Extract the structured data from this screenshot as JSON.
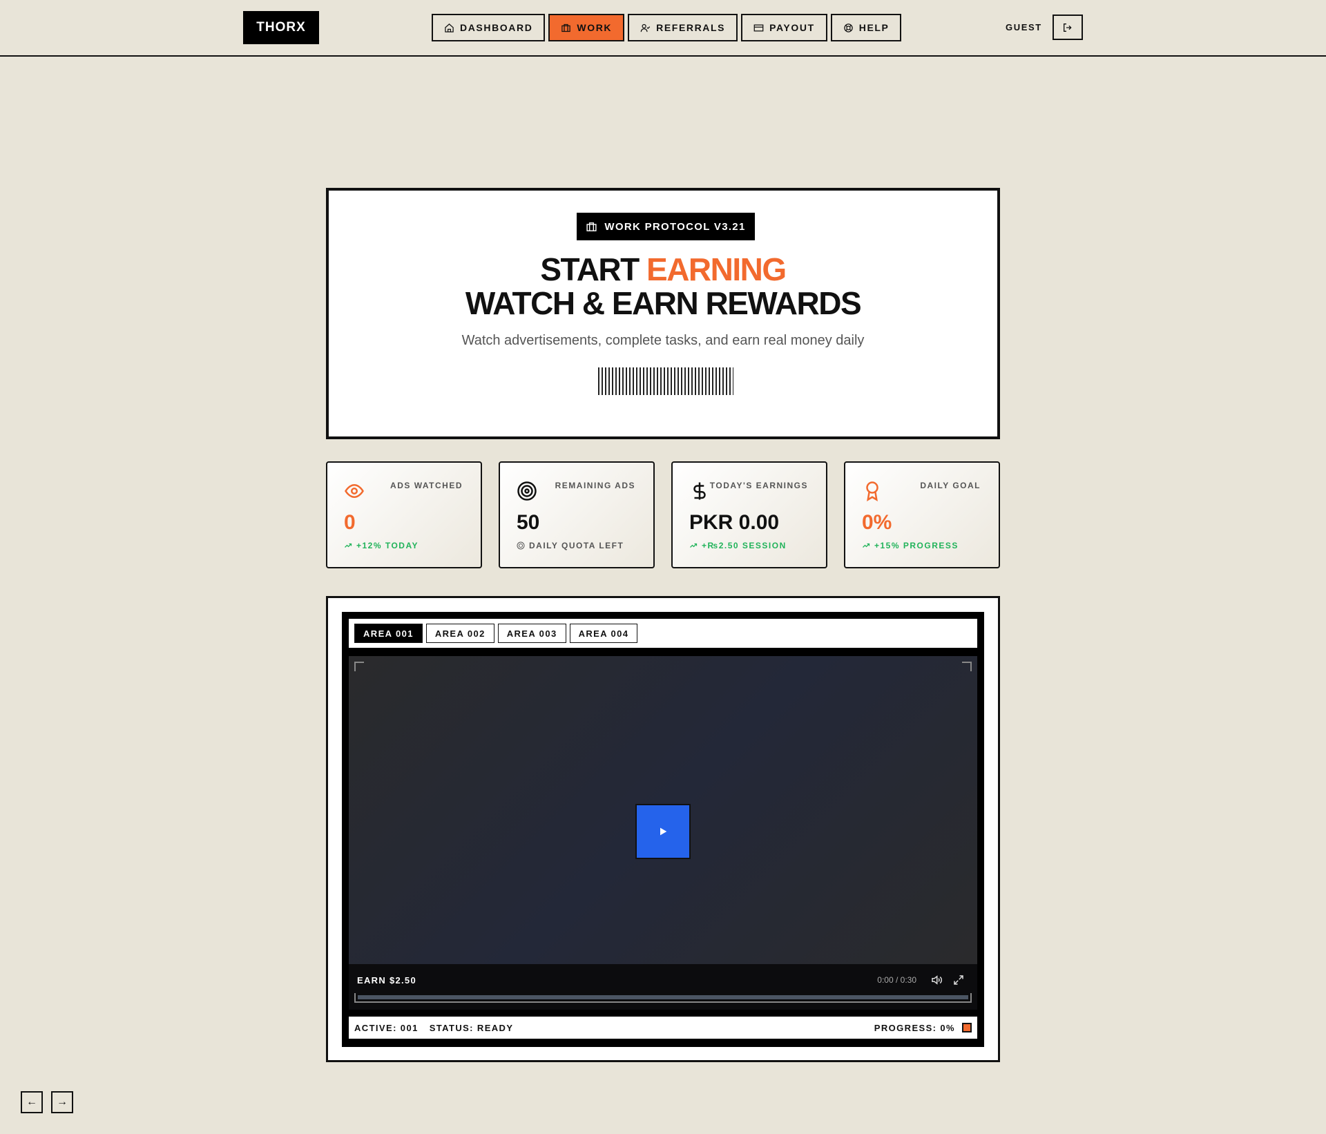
{
  "header": {
    "logo": "THORX",
    "nav": [
      {
        "label": "DASHBOARD",
        "icon": "home-icon",
        "active": false
      },
      {
        "label": "WORK",
        "icon": "briefcase-icon",
        "active": true
      },
      {
        "label": "REFERRALS",
        "icon": "user-check-icon",
        "active": false
      },
      {
        "label": "PAYOUT",
        "icon": "credit-card-icon",
        "active": false
      },
      {
        "label": "HELP",
        "icon": "lifebuoy-icon",
        "active": false
      }
    ],
    "user": "GUEST",
    "logout_icon": "logout-icon"
  },
  "hero": {
    "badge": "WORK PROTOCOL V3.21",
    "title_part1": "START ",
    "title_highlight": "EARNING",
    "title_line2": "WATCH & EARN REWARDS",
    "subtitle": "Watch advertisements, complete tasks, and earn real money daily"
  },
  "stats": [
    {
      "label": "ADS WATCHED",
      "value": "0",
      "sub": "+12% TODAY",
      "icon": "eye-icon"
    },
    {
      "label": "REMAINING ADS",
      "value": "50",
      "sub": "DAILY QUOTA LEFT",
      "icon": "target-icon"
    },
    {
      "label": "TODAY'S EARNINGS",
      "value": "PKR 0.00",
      "sub": "+₨2.50 SESSION",
      "icon": "dollar-icon"
    },
    {
      "label": "DAILY GOAL",
      "value": "0%",
      "sub": "+15% PROGRESS",
      "icon": "award-icon"
    }
  ],
  "player": {
    "tabs": [
      "AREA 001",
      "AREA 002",
      "AREA 003",
      "AREA 004"
    ],
    "earn_label": "EARN $2.50",
    "time": "0:00 / 0:30",
    "progress_fraction": 0,
    "status_active": "ACTIVE: 001",
    "status_state": "STATUS: READY",
    "status_progress": "PROGRESS: 0%"
  },
  "pager": {
    "prev": "←",
    "next": "→"
  },
  "colors": {
    "accent": "#f26a2e",
    "background": "#e8e4d8",
    "play": "#2563eb",
    "positive": "#21b35a"
  }
}
